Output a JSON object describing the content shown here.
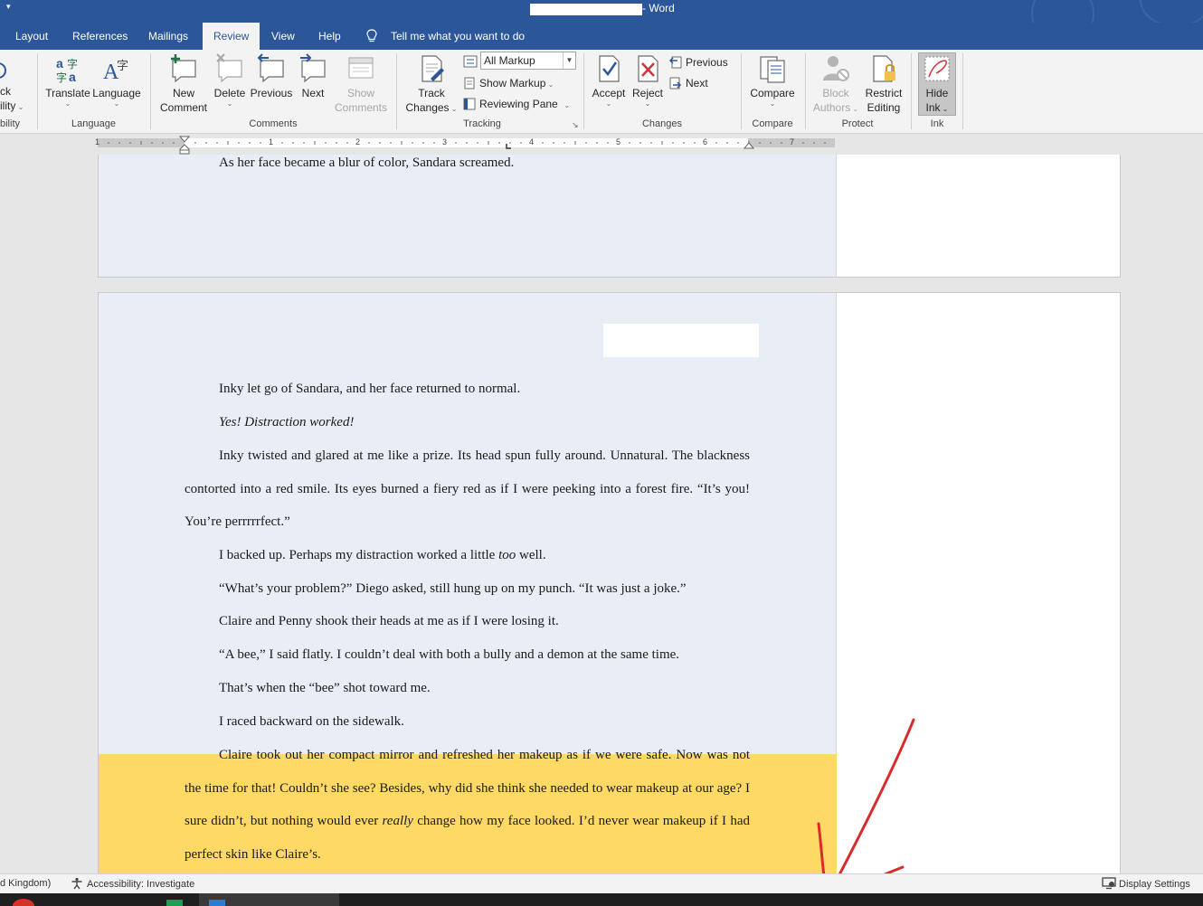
{
  "titlebar": {
    "title_suffix": "- Word"
  },
  "tabs": [
    {
      "label": "Layout"
    },
    {
      "label": "References"
    },
    {
      "label": "Mailings"
    },
    {
      "label": "Review"
    },
    {
      "label": "View"
    },
    {
      "label": "Help"
    }
  ],
  "tell_me": {
    "label": "Tell me what you want to do"
  },
  "ribbon": {
    "accessibility": {
      "line1": "ck",
      "line2": "ility",
      "group_label": "bility"
    },
    "language": {
      "translate": "Translate",
      "language": "Language",
      "group_label": "Language"
    },
    "comments": {
      "new_line1": "New",
      "new_line2": "Comment",
      "delete": "Delete",
      "previous": "Previous",
      "next": "Next",
      "show_line1": "Show",
      "show_line2": "Comments",
      "group_label": "Comments"
    },
    "tracking": {
      "track_line1": "Track",
      "track_line2": "Changes",
      "markup_value": "All Markup",
      "show_markup": "Show Markup",
      "reviewing_pane": "Reviewing Pane",
      "group_label": "Tracking"
    },
    "changes": {
      "accept": "Accept",
      "reject": "Reject",
      "previous": "Previous",
      "next": "Next",
      "group_label": "Changes"
    },
    "compare": {
      "compare": "Compare",
      "group_label": "Compare"
    },
    "protect": {
      "block_line1": "Block",
      "block_line2": "Authors",
      "restrict_line1": "Restrict",
      "restrict_line2": "Editing",
      "group_label": "Protect"
    },
    "ink": {
      "hide_line1": "Hide",
      "hide_line2": "Ink",
      "group_label": "Ink"
    }
  },
  "ruler": {
    "numbers": [
      "1",
      "1",
      "2",
      "3",
      "4",
      "5",
      "6",
      "7"
    ]
  },
  "document": {
    "page1_text": "As her face became a blur of color, Sandara screamed.",
    "p1": "Inky let go of Sandara, and her face returned to normal.",
    "p2": "Yes! Distraction worked!",
    "p3": "Inky twisted and glared at me like a prize. Its head spun fully around. Unnatural. The blackness contorted into a red smile. Its eyes burned a fiery red as if I were peeking into a forest fire. “It’s you! You’re perrrrrfect.”",
    "p4_a": "I backed up. Perhaps my distraction worked a little ",
    "p4_em": "too",
    "p4_b": " well.",
    "p5": "“What’s your problem?” Diego asked, still hung up on my punch. “It was just a joke.”",
    "p6": "Claire and Penny shook their heads at me as if I were losing it.",
    "p7": "“A bee,” I said flatly. I couldn’t deal with both a bully and a demon at the same time.",
    "p8": "That’s when the “bee” shot toward me.",
    "p9": "I raced backward on the sidewalk.",
    "p10_a": "Claire took out her compact mirror and refreshed her makeup as if we were safe. Now was not the time for that! Couldn’t she see? Besides, why did she think she needed to wear makeup at our age? I sure didn’t, but nothing would ever ",
    "p10_em": "really",
    "p10_b": " change how my face looked. I’d never wear makeup if I had perfect skin like Claire’s."
  },
  "statusbar": {
    "language": "d Kingdom)",
    "accessibility": "Accessibility: Investigate",
    "display_settings": "Display Settings"
  },
  "colors": {
    "title_blue": "#2b579a",
    "highlight_yellow": "#fed966",
    "annotation_red": "#d92b2b"
  }
}
